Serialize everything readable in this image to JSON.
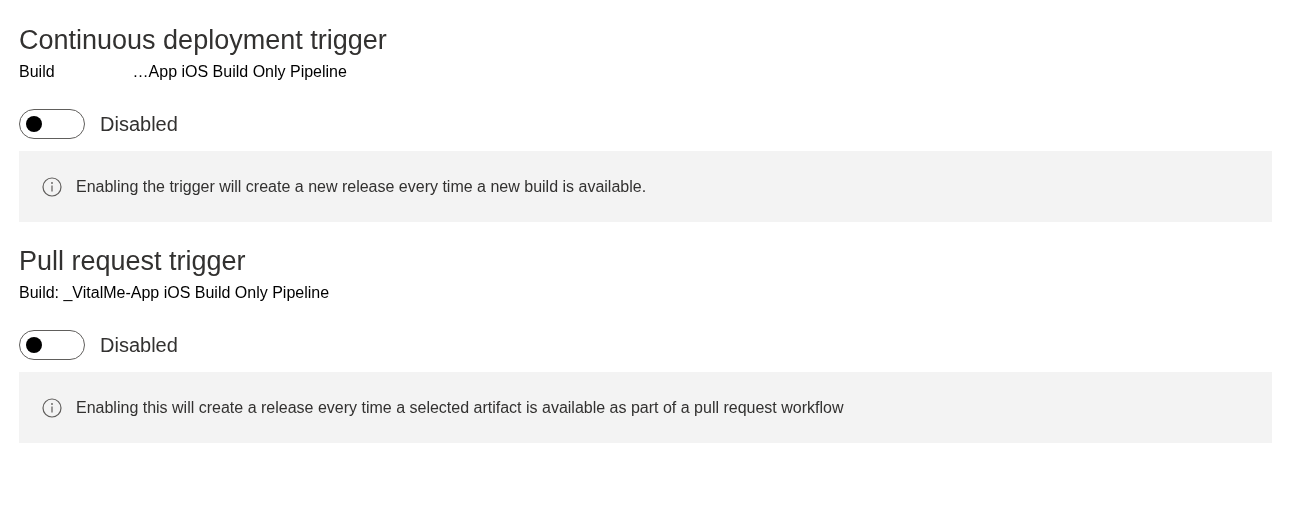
{
  "sections": [
    {
      "title": "Continuous deployment trigger",
      "source_label": "Build",
      "source_value": "…App iOS Build Only Pipeline",
      "toggle": {
        "on": false,
        "label": "Disabled"
      },
      "info": "Enabling the trigger will create a new release every time a new build is available."
    },
    {
      "title": "Pull request trigger",
      "source_label": "Build: _VitalMe-App iOS Build Only Pipeline",
      "toggle": {
        "on": false,
        "label": "Disabled"
      },
      "info": "Enabling this will create a release every time a selected artifact is available as part of a pull request workflow"
    }
  ]
}
